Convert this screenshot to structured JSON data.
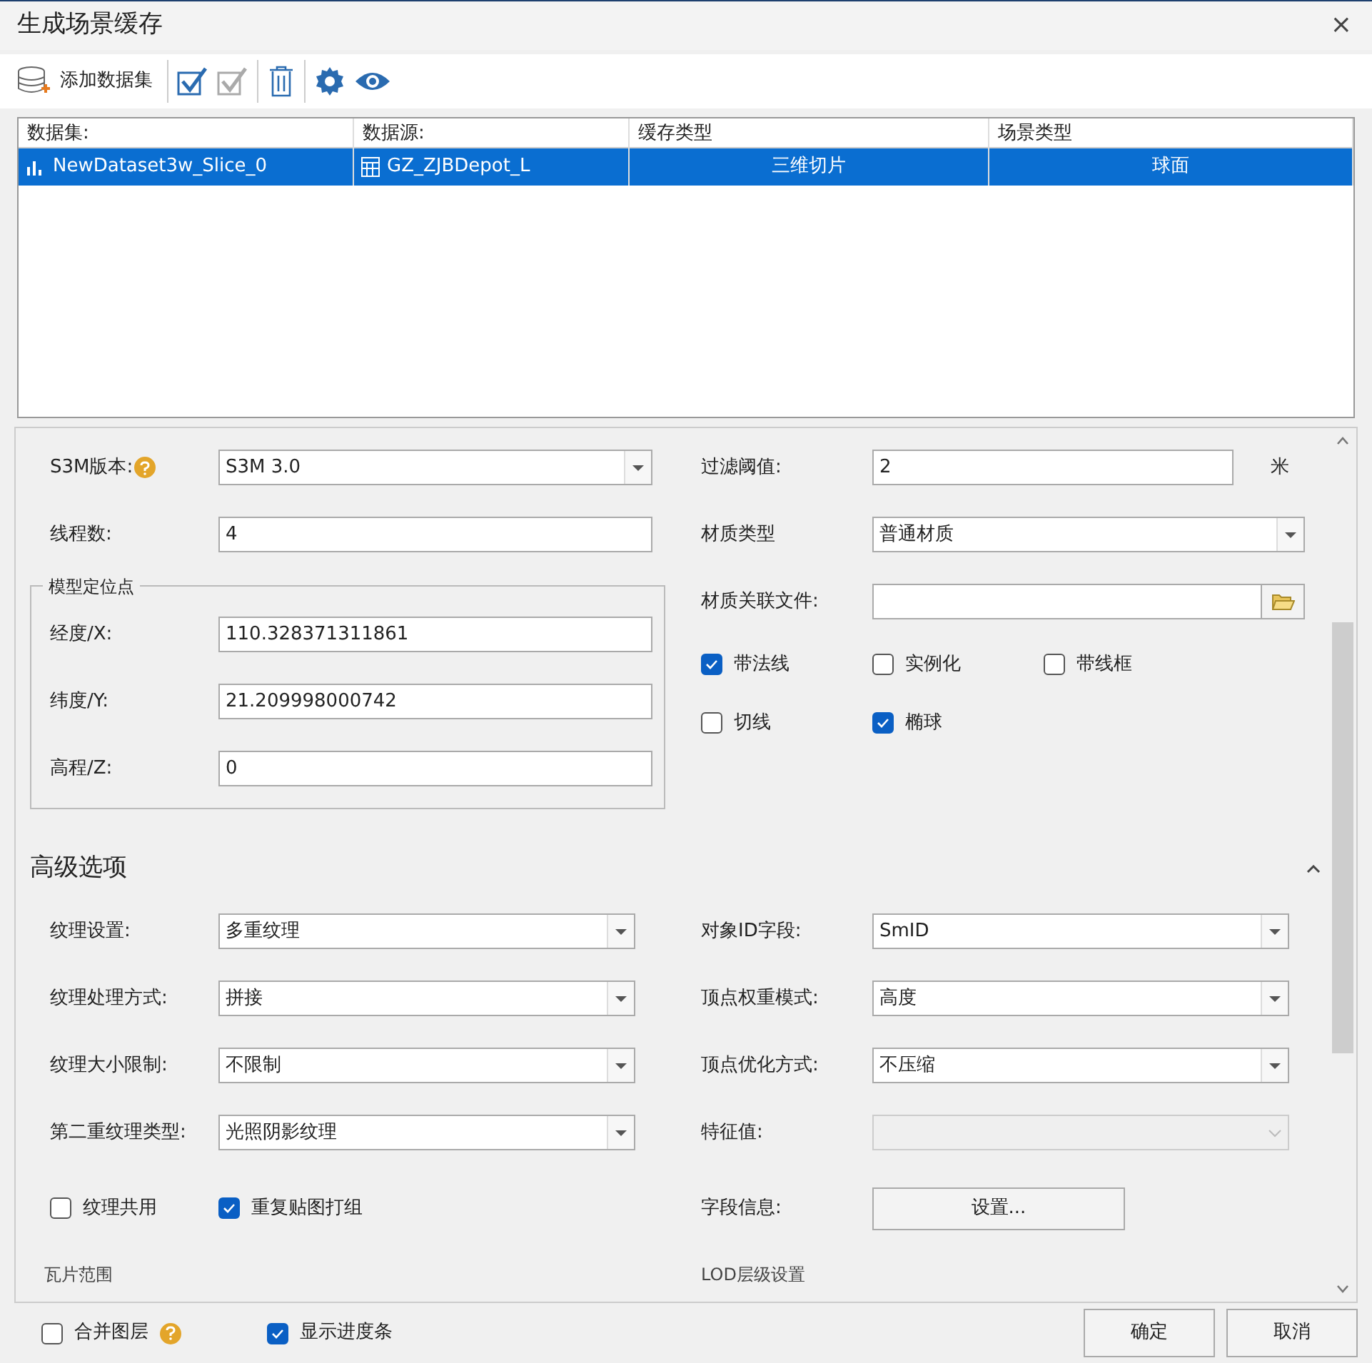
{
  "window": {
    "title": "生成场景缓存",
    "close": "×"
  },
  "toolbar": {
    "add_label": "添加数据集"
  },
  "table": {
    "columns": [
      "数据集:",
      "数据源:",
      "缓存类型",
      "场景类型"
    ],
    "rows": [
      {
        "selected": true,
        "cells": [
          "NewDataset3w_Slice_0",
          "GZ_ZJBDepot_L",
          "三维切片",
          "球面"
        ]
      }
    ]
  },
  "basic": {
    "left": [
      {
        "kind": "dropdown",
        "label": "S3M版本:",
        "value": "S3M 3.0",
        "help": true
      },
      {
        "kind": "text",
        "label": "线程数:",
        "value": "4"
      }
    ],
    "group": {
      "title": "模型定位点",
      "fields": [
        {
          "kind": "text",
          "label": "经度/X:",
          "value": "110.328371311861"
        },
        {
          "kind": "text",
          "label": "纬度/Y:",
          "value": "21.209998000742"
        },
        {
          "kind": "text",
          "label": "高程/Z:",
          "value": "0"
        }
      ]
    },
    "right": [
      {
        "kind": "text",
        "label": "过滤阈值:",
        "value": "2",
        "unit": "米"
      },
      {
        "kind": "dropdown",
        "label": "材质类型",
        "value": "普通材质"
      },
      {
        "kind": "file",
        "label": "材质关联文件:"
      }
    ],
    "checkbox_rows": [
      [
        {
          "label": "带法线",
          "checked": true
        },
        {
          "label": "实例化",
          "checked": false
        },
        {
          "label": "带线框",
          "checked": false
        }
      ],
      [
        {
          "label": "切线",
          "checked": false
        },
        {
          "label": "椭球",
          "checked": true
        }
      ]
    ]
  },
  "advanced": {
    "title": "高级选项",
    "expanded": true,
    "left": [
      {
        "kind": "dropdown",
        "label": "纹理设置:",
        "value": "多重纹理"
      },
      {
        "kind": "dropdown",
        "label": "纹理处理方式:",
        "value": "拼接"
      },
      {
        "kind": "dropdown",
        "label": "纹理大小限制:",
        "value": "不限制"
      },
      {
        "kind": "dropdown",
        "label": "第二重纹理类型:",
        "value": "光照阴影纹理"
      }
    ],
    "checkboxes": [
      {
        "label": "纹理共用",
        "checked": false
      },
      {
        "label": "重复贴图打组",
        "checked": true
      }
    ],
    "right": [
      {
        "kind": "dropdown",
        "label": "对象ID字段:",
        "value": "SmID"
      },
      {
        "kind": "dropdown",
        "label": "顶点权重模式:",
        "value": "高度"
      },
      {
        "kind": "dropdown",
        "label": "顶点优化方式:",
        "value": "不压缩"
      },
      {
        "kind": "disabled-dropdown",
        "label": "特征值:"
      },
      {
        "kind": "button",
        "label": "字段信息:",
        "value": "设置..."
      }
    ],
    "next_sections": [
      "瓦片范围",
      "LOD层级设置"
    ]
  },
  "footer": {
    "checkboxes": [
      {
        "label": "合并图层",
        "checked": false,
        "help": true
      },
      {
        "label": "显示进度条",
        "checked": true
      }
    ],
    "buttons": [
      "确定",
      "取消"
    ]
  }
}
